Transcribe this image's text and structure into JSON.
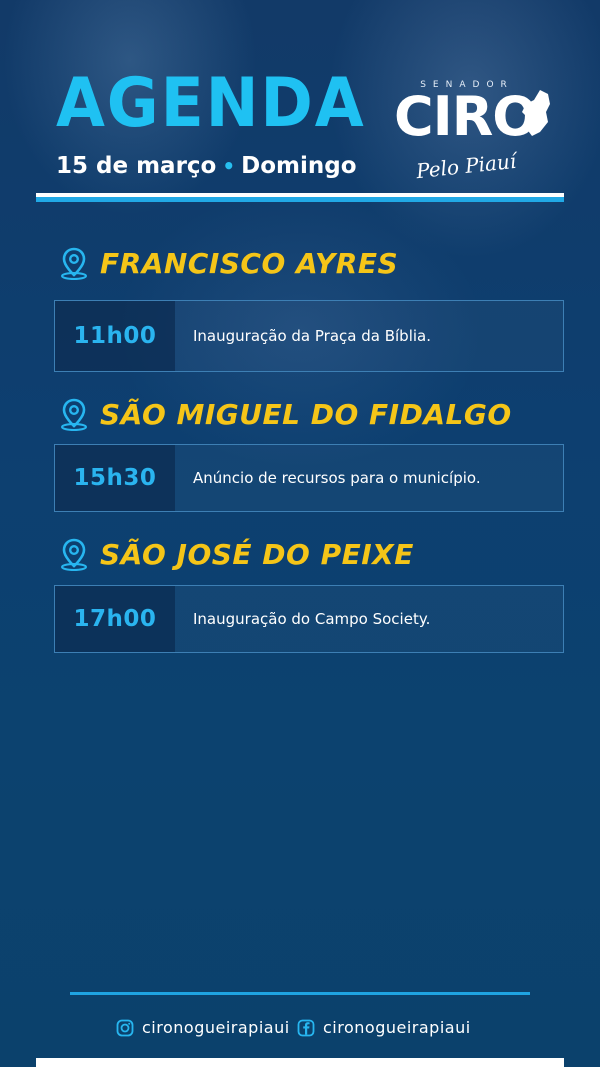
{
  "header": {
    "title": "AGENDA",
    "date": "15 de março",
    "separator": "•",
    "weekday": "Domingo"
  },
  "logo": {
    "top_text": "SENADOR",
    "name": "CIRO",
    "tagline": "Pelo Piauí"
  },
  "stops": [
    {
      "city": "FRANCISCO AYRES",
      "time": "11h00",
      "description": "Inauguração da Praça da Bíblia."
    },
    {
      "city": "SÃO MIGUEL DO FIDALGO",
      "time": "15h30",
      "description": "Anúncio de recursos para o município."
    },
    {
      "city": "SÃO JOSÉ DO PEIXE",
      "time": "17h00",
      "description": "Inauguração do Campo Society."
    }
  ],
  "footer": {
    "instagram": "cironogueirapiaui",
    "facebook": "cironogueirapiaui"
  },
  "colors": {
    "background": "#0d4170",
    "title": "#1fc1f2",
    "city": "#f5c518",
    "time": "#2ab4ef",
    "accent_rule": "#21a9e6"
  },
  "icons": [
    "location-pin-icon",
    "instagram-icon",
    "facebook-icon"
  ]
}
